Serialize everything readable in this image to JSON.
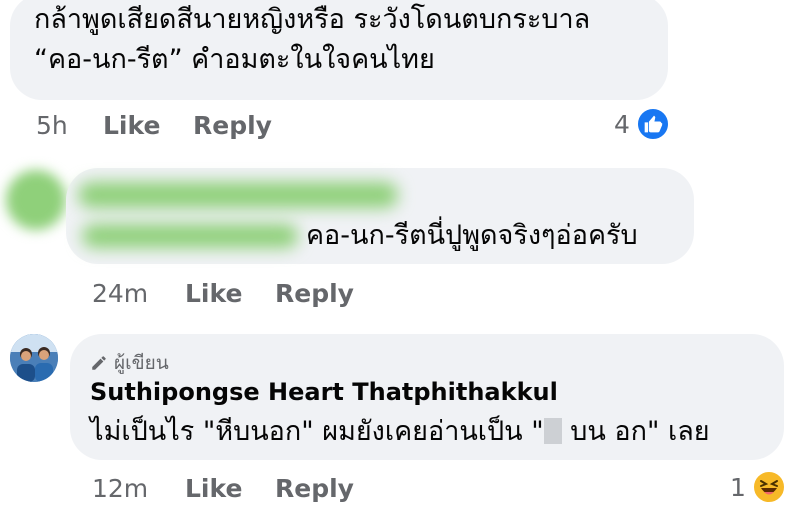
{
  "comments": [
    {
      "text_line1": "กล้าพูดเสียดสีนายหญิงหรือ ระวังโดนตบกระบาล",
      "text_line2": "“คอ-นก-รีต” คำอมตะในใจคนไทย",
      "time": "5h",
      "like_label": "Like",
      "reply_label": "Reply",
      "reaction_count": "4",
      "reaction_icon": "thumbs-up-icon"
    },
    {
      "author": "",
      "text": "คอ-นก-รีตนี่ปูพูดจริงๆอ่อครับ",
      "time": "24m",
      "like_label": "Like",
      "reply_label": "Reply"
    },
    {
      "badge": "ผู้เขียน",
      "badge_icon": "pencil-icon",
      "author": "Suthipongse Heart Thatphithakkul",
      "text_part1": "ไม่เป็นไร  \"หีบนอก\" ผมยังเคยอ่านเป็น \"",
      "text_part2": " บน อก\" เลย",
      "time": "12m",
      "like_label": "Like",
      "reply_label": "Reply",
      "reaction_count": "1",
      "reaction_icon": "laughing-emoji-icon"
    }
  ],
  "colors": {
    "bubble": "#f0f2f5",
    "meta_text": "#65676b",
    "like_blue": "#1877f2",
    "haha_yellow": "#f7b928",
    "blur_green": "#8fd07a"
  }
}
